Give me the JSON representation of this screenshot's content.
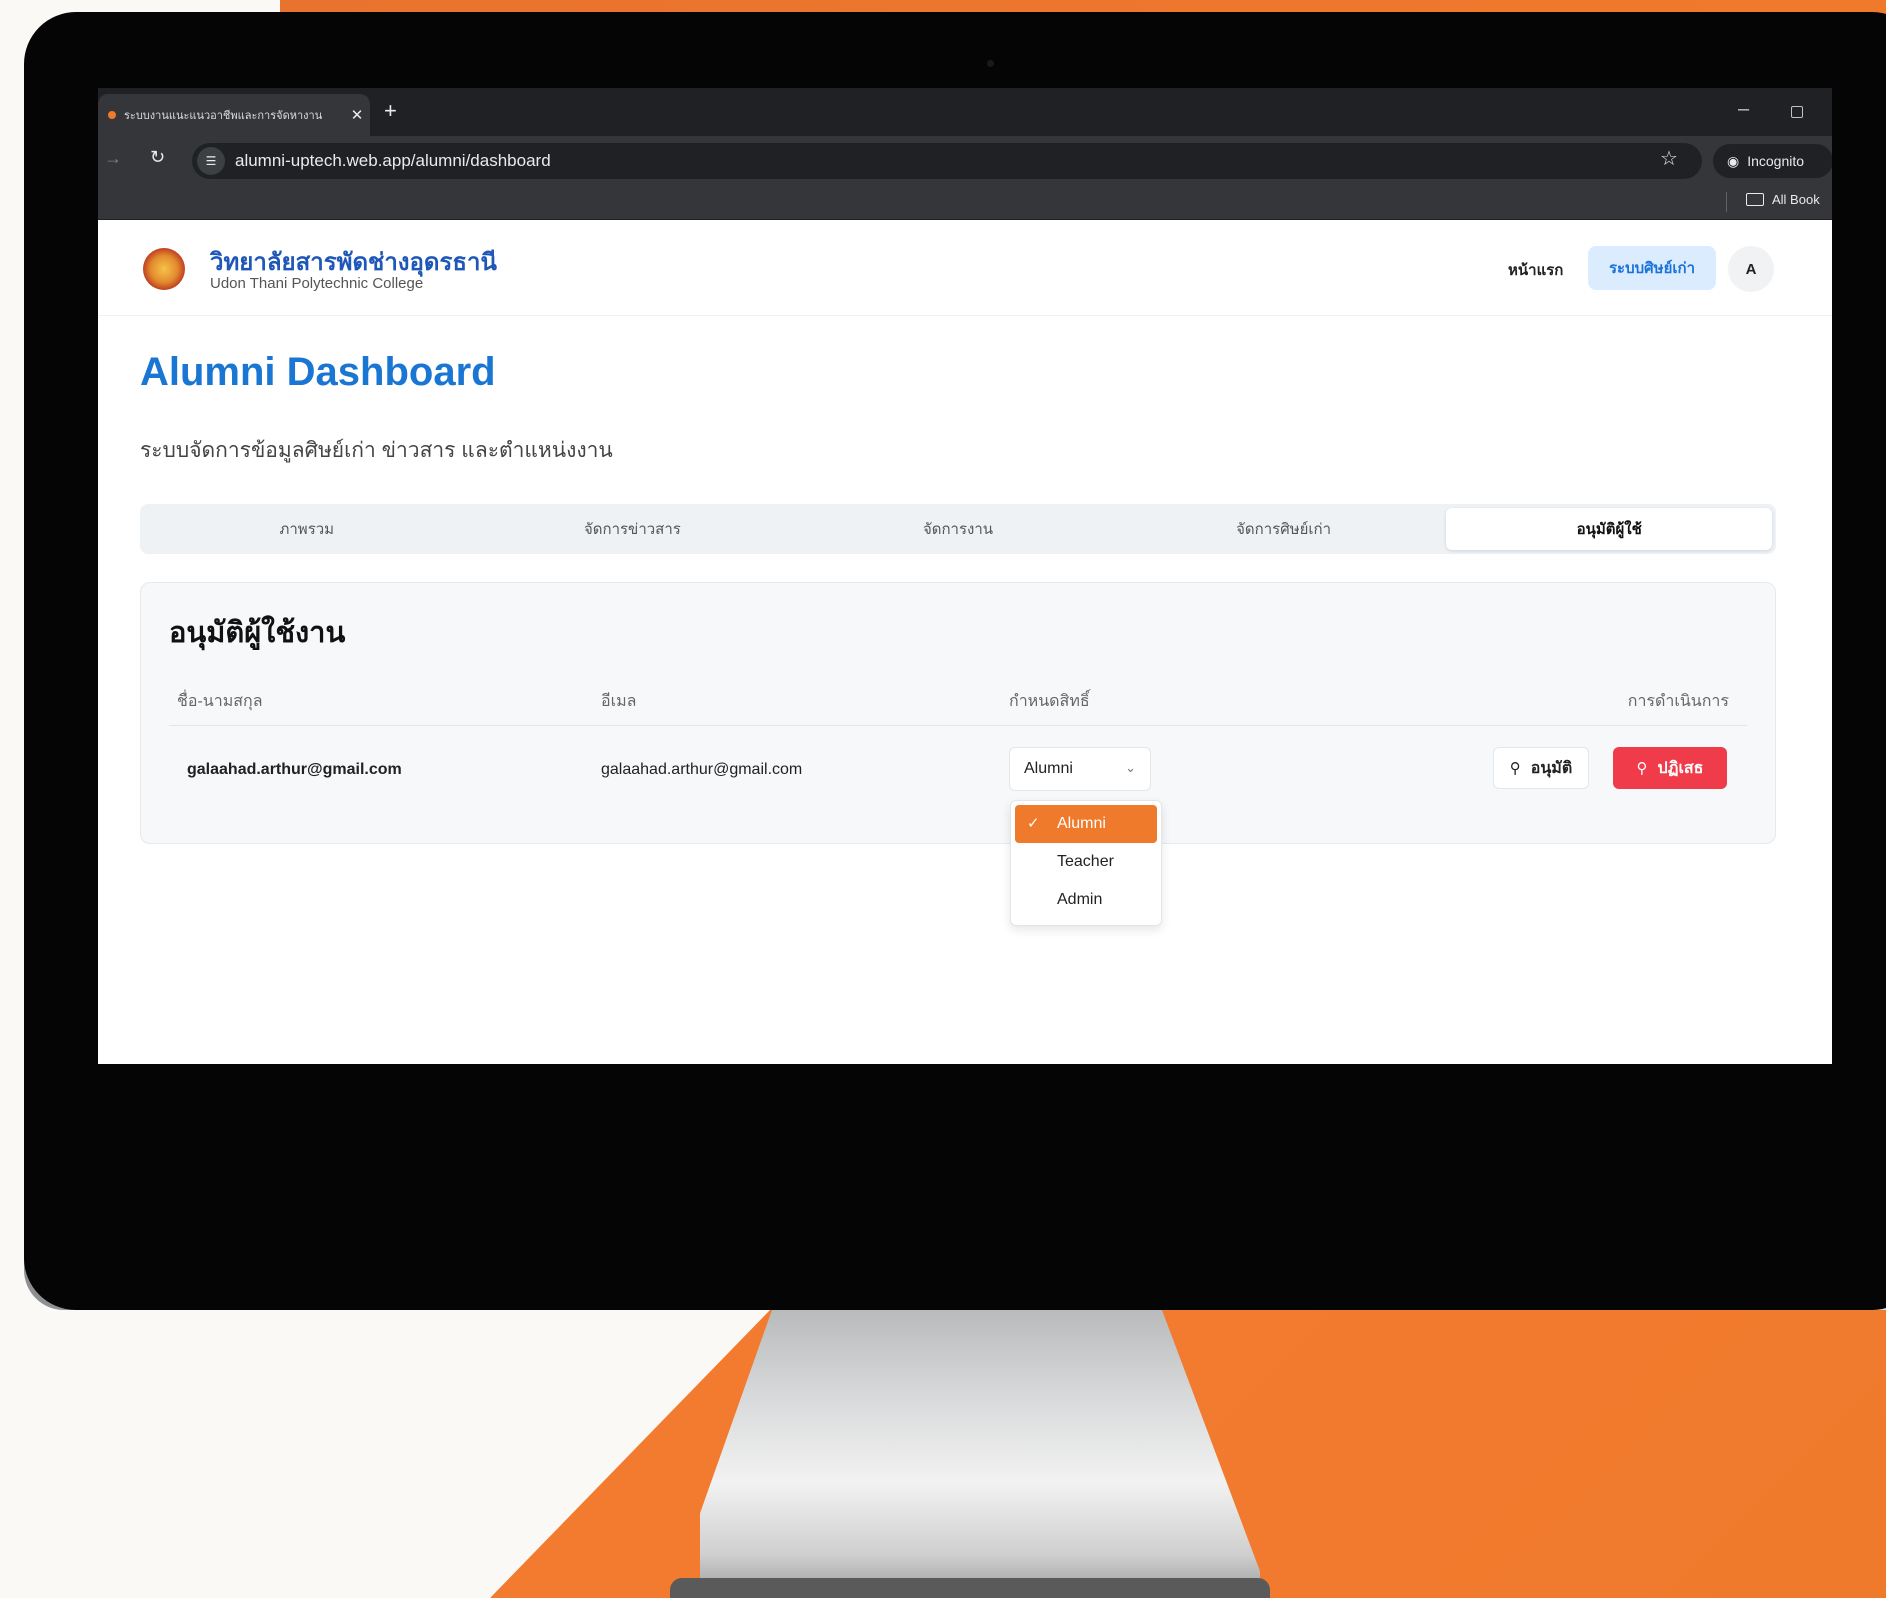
{
  "browser": {
    "tab_title": "ระบบงานแนะแนวอาชีพและการจัดหางาน",
    "tab_close": "✕",
    "new_tab": "+",
    "url": "alumni-uptech.web.app/alumni/dashboard",
    "incognito_label": "Incognito",
    "all_bookmarks": "All Book"
  },
  "header": {
    "brand_th": "วิทยาลัยสารพัดช่างอุดรธานี",
    "brand_en": "Udon Thani Polytechnic College",
    "nav_home": "หน้าแรก",
    "nav_alumni": "ระบบศิษย์เก่า",
    "avatar_initial": "A"
  },
  "main": {
    "title": "Alumni Dashboard",
    "subtitle": "ระบบจัดการข้อมูลศิษย์เก่า ข่าวสาร และตำแหน่งงาน",
    "tabs": [
      {
        "label": "ภาพรวม",
        "active": false
      },
      {
        "label": "จัดการข่าวสาร",
        "active": false
      },
      {
        "label": "จัดการงาน",
        "active": false
      },
      {
        "label": "จัดการศิษย์เก่า",
        "active": false
      },
      {
        "label": "อนุมัติผู้ใช้",
        "active": true
      }
    ]
  },
  "approval": {
    "title": "อนุมัติผู้ใช้งาน",
    "columns": {
      "name": "ชื่อ-นามสกุล",
      "email": "อีเมล",
      "role": "กำหนดสิทธิ์",
      "actions": "การดำเนินการ"
    },
    "rows": [
      {
        "name": "galaahad.arthur@gmail.com",
        "email": "galaahad.arthur@gmail.com",
        "role": "Alumni"
      }
    ],
    "approve_label": "อนุมัติ",
    "reject_label": "ปฏิเสธ",
    "role_options": [
      "Alumni",
      "Teacher",
      "Admin"
    ],
    "selected_role": "Alumni"
  },
  "colors": {
    "accent": "#f07a2c",
    "brand_blue": "#1976d2",
    "reject_red": "#ef3b4a"
  }
}
